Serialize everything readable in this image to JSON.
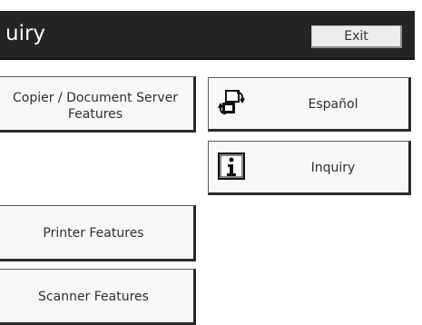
{
  "header": {
    "title": "uiry",
    "exit_label": "Exit"
  },
  "buttons": {
    "copier": {
      "line1": "Copier / Document Server",
      "line2": "Features"
    },
    "printer": "Printer Features",
    "scanner": "Scanner Features",
    "espanol": {
      "label": "Español",
      "icon": "language-switch-icon"
    },
    "inquiry": {
      "label": "Inquiry",
      "icon": "info-icon"
    }
  },
  "colors": {
    "header_bg": "#242424",
    "header_text": "#ffffff",
    "button_bg": "#f7f7f7",
    "button_border": "#2a2a2a"
  }
}
